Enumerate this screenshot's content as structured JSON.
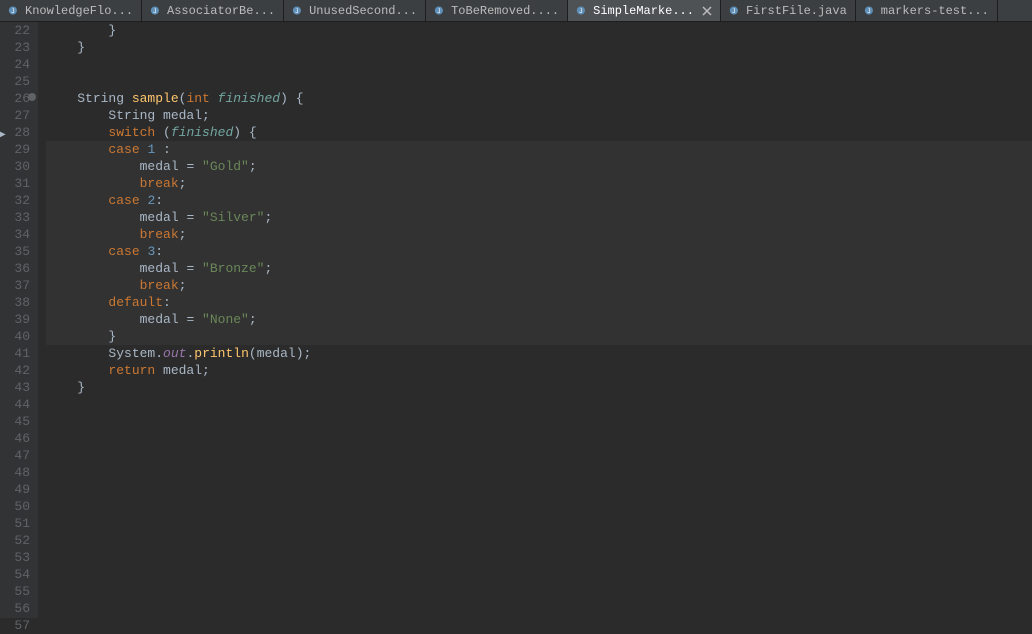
{
  "tabs": [
    {
      "label": "KnowledgeFlo...",
      "active": false
    },
    {
      "label": "AssociatorBe...",
      "active": false
    },
    {
      "label": "UnusedSecond...",
      "active": false
    },
    {
      "label": "ToBeRemoved....",
      "active": false
    },
    {
      "label": "SimpleMarke...",
      "active": true
    },
    {
      "label": "FirstFile.java",
      "active": false
    },
    {
      "label": "markers-test...",
      "active": false
    }
  ],
  "gutter": {
    "start": 22,
    "end": 57,
    "marker_line": 26,
    "arrow_line": 28
  },
  "code": {
    "lines": [
      {
        "n": 22,
        "hl": false,
        "tokens": [
          {
            "cls": "punct",
            "t": "        }"
          }
        ]
      },
      {
        "n": 23,
        "hl": false,
        "tokens": [
          {
            "cls": "punct",
            "t": "    }"
          }
        ]
      },
      {
        "n": 24,
        "hl": false,
        "tokens": []
      },
      {
        "n": 25,
        "hl": false,
        "tokens": []
      },
      {
        "n": 26,
        "hl": false,
        "tokens": [
          {
            "cls": "punct",
            "t": "    "
          },
          {
            "cls": "type",
            "t": "String "
          },
          {
            "cls": "method",
            "t": "sample"
          },
          {
            "cls": "punct",
            "t": "("
          },
          {
            "cls": "kw",
            "t": "int "
          },
          {
            "cls": "param",
            "t": "finished"
          },
          {
            "cls": "punct",
            "t": ") {"
          }
        ]
      },
      {
        "n": 27,
        "hl": false,
        "tokens": [
          {
            "cls": "punct",
            "t": "        "
          },
          {
            "cls": "type",
            "t": "String "
          },
          {
            "cls": "ident",
            "t": "medal"
          },
          {
            "cls": "punct",
            "t": ";"
          }
        ]
      },
      {
        "n": 28,
        "hl": false,
        "tokens": [
          {
            "cls": "punct",
            "t": "        "
          },
          {
            "cls": "kw",
            "t": "switch "
          },
          {
            "cls": "punct",
            "t": "("
          },
          {
            "cls": "param",
            "t": "finished"
          },
          {
            "cls": "punct",
            "t": ") {"
          }
        ]
      },
      {
        "n": 29,
        "hl": true,
        "tokens": [
          {
            "cls": "punct",
            "t": "        "
          },
          {
            "cls": "kw",
            "t": "case "
          },
          {
            "cls": "num",
            "t": "1"
          },
          {
            "cls": "punct",
            "t": " :"
          }
        ]
      },
      {
        "n": 30,
        "hl": true,
        "tokens": [
          {
            "cls": "punct",
            "t": "            "
          },
          {
            "cls": "ident",
            "t": "medal "
          },
          {
            "cls": "punct",
            "t": "= "
          },
          {
            "cls": "str",
            "t": "\"Gold\""
          },
          {
            "cls": "punct",
            "t": ";"
          }
        ]
      },
      {
        "n": 31,
        "hl": true,
        "tokens": [
          {
            "cls": "punct",
            "t": "            "
          },
          {
            "cls": "kw",
            "t": "break"
          },
          {
            "cls": "punct",
            "t": ";"
          }
        ]
      },
      {
        "n": 32,
        "hl": true,
        "tokens": [
          {
            "cls": "punct",
            "t": "        "
          },
          {
            "cls": "kw",
            "t": "case "
          },
          {
            "cls": "num",
            "t": "2"
          },
          {
            "cls": "punct",
            "t": ":"
          }
        ]
      },
      {
        "n": 33,
        "hl": true,
        "tokens": [
          {
            "cls": "punct",
            "t": "            "
          },
          {
            "cls": "ident",
            "t": "medal "
          },
          {
            "cls": "punct",
            "t": "= "
          },
          {
            "cls": "str",
            "t": "\"Silver\""
          },
          {
            "cls": "punct",
            "t": ";"
          }
        ]
      },
      {
        "n": 34,
        "hl": true,
        "tokens": [
          {
            "cls": "punct",
            "t": "            "
          },
          {
            "cls": "kw",
            "t": "break"
          },
          {
            "cls": "punct",
            "t": ";"
          }
        ]
      },
      {
        "n": 35,
        "hl": true,
        "tokens": [
          {
            "cls": "punct",
            "t": "        "
          },
          {
            "cls": "kw",
            "t": "case "
          },
          {
            "cls": "num",
            "t": "3"
          },
          {
            "cls": "punct",
            "t": ":"
          }
        ]
      },
      {
        "n": 36,
        "hl": true,
        "tokens": [
          {
            "cls": "punct",
            "t": "            "
          },
          {
            "cls": "ident",
            "t": "medal "
          },
          {
            "cls": "punct",
            "t": "= "
          },
          {
            "cls": "str",
            "t": "\"Bronze\""
          },
          {
            "cls": "punct",
            "t": ";"
          }
        ]
      },
      {
        "n": 37,
        "hl": true,
        "tokens": [
          {
            "cls": "punct",
            "t": "            "
          },
          {
            "cls": "kw",
            "t": "break"
          },
          {
            "cls": "punct",
            "t": ";"
          }
        ]
      },
      {
        "n": 38,
        "hl": true,
        "tokens": [
          {
            "cls": "punct",
            "t": "        "
          },
          {
            "cls": "kw",
            "t": "default"
          },
          {
            "cls": "punct",
            "t": ":"
          }
        ]
      },
      {
        "n": 39,
        "hl": true,
        "tokens": [
          {
            "cls": "punct",
            "t": "            "
          },
          {
            "cls": "ident",
            "t": "medal "
          },
          {
            "cls": "punct",
            "t": "= "
          },
          {
            "cls": "str",
            "t": "\"None\""
          },
          {
            "cls": "punct",
            "t": ";"
          }
        ]
      },
      {
        "n": 40,
        "hl": true,
        "tokens": [
          {
            "cls": "punct",
            "t": "        }"
          }
        ]
      },
      {
        "n": 41,
        "hl": false,
        "tokens": [
          {
            "cls": "punct",
            "t": "        "
          },
          {
            "cls": "sys",
            "t": "System"
          },
          {
            "cls": "punct",
            "t": "."
          },
          {
            "cls": "field",
            "t": "out"
          },
          {
            "cls": "punct",
            "t": "."
          },
          {
            "cls": "method",
            "t": "println"
          },
          {
            "cls": "punct",
            "t": "("
          },
          {
            "cls": "ident",
            "t": "medal"
          },
          {
            "cls": "punct",
            "t": ");"
          }
        ]
      },
      {
        "n": 42,
        "hl": false,
        "tokens": [
          {
            "cls": "punct",
            "t": "        "
          },
          {
            "cls": "kw",
            "t": "return "
          },
          {
            "cls": "ident",
            "t": "medal"
          },
          {
            "cls": "punct",
            "t": ";"
          }
        ]
      },
      {
        "n": 43,
        "hl": false,
        "tokens": [
          {
            "cls": "punct",
            "t": "    }"
          }
        ]
      },
      {
        "n": 44,
        "hl": false,
        "tokens": []
      },
      {
        "n": 45,
        "hl": false,
        "tokens": []
      },
      {
        "n": 46,
        "hl": false,
        "tokens": []
      },
      {
        "n": 47,
        "hl": false,
        "tokens": []
      },
      {
        "n": 48,
        "hl": false,
        "tokens": []
      },
      {
        "n": 49,
        "hl": false,
        "tokens": []
      },
      {
        "n": 50,
        "hl": false,
        "tokens": []
      },
      {
        "n": 51,
        "hl": false,
        "tokens": []
      },
      {
        "n": 52,
        "hl": false,
        "tokens": []
      },
      {
        "n": 53,
        "hl": false,
        "tokens": []
      },
      {
        "n": 54,
        "hl": false,
        "tokens": []
      },
      {
        "n": 55,
        "hl": false,
        "tokens": []
      },
      {
        "n": 56,
        "hl": false,
        "tokens": []
      },
      {
        "n": 57,
        "hl": false,
        "tokens": []
      }
    ]
  }
}
